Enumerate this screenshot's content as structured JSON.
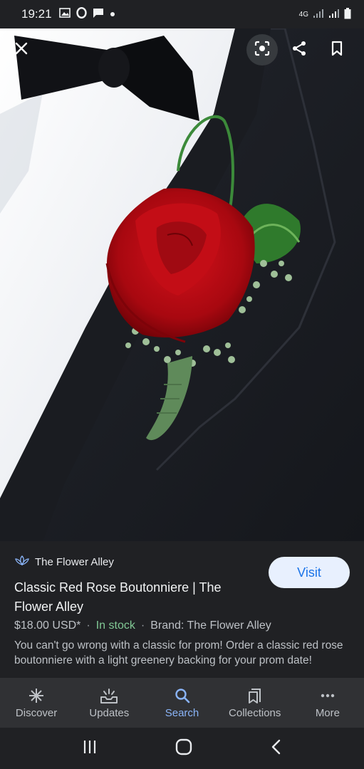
{
  "status_bar": {
    "time": "19:21",
    "network_label": "4G"
  },
  "image": {
    "alt": "Classic Red Rose Boutonniere"
  },
  "details": {
    "source_name": "The Flower Alley",
    "visit_label": "Visit",
    "title": "Classic Red Rose Boutonniere | The Flower Alley",
    "price": "$18.00 USD*",
    "stock": "In stock",
    "brand": "Brand: The Flower Alley",
    "description": "You can't go wrong with a classic for prom! Order a classic red rose boutonniere with a light greenery backing for your prom date!"
  },
  "bottom_nav": {
    "items": [
      {
        "label": "Discover",
        "icon": "asterisk-icon"
      },
      {
        "label": "Updates",
        "icon": "updates-icon"
      },
      {
        "label": "Search",
        "icon": "search-icon"
      },
      {
        "label": "Collections",
        "icon": "collections-icon"
      },
      {
        "label": "More",
        "icon": "more-dots-icon"
      }
    ],
    "active": "Search"
  },
  "colors": {
    "accent": "#8ab4f8",
    "stock_green": "#81c995",
    "visit_bg": "#e8f0fe",
    "visit_text": "#1a73e8"
  }
}
